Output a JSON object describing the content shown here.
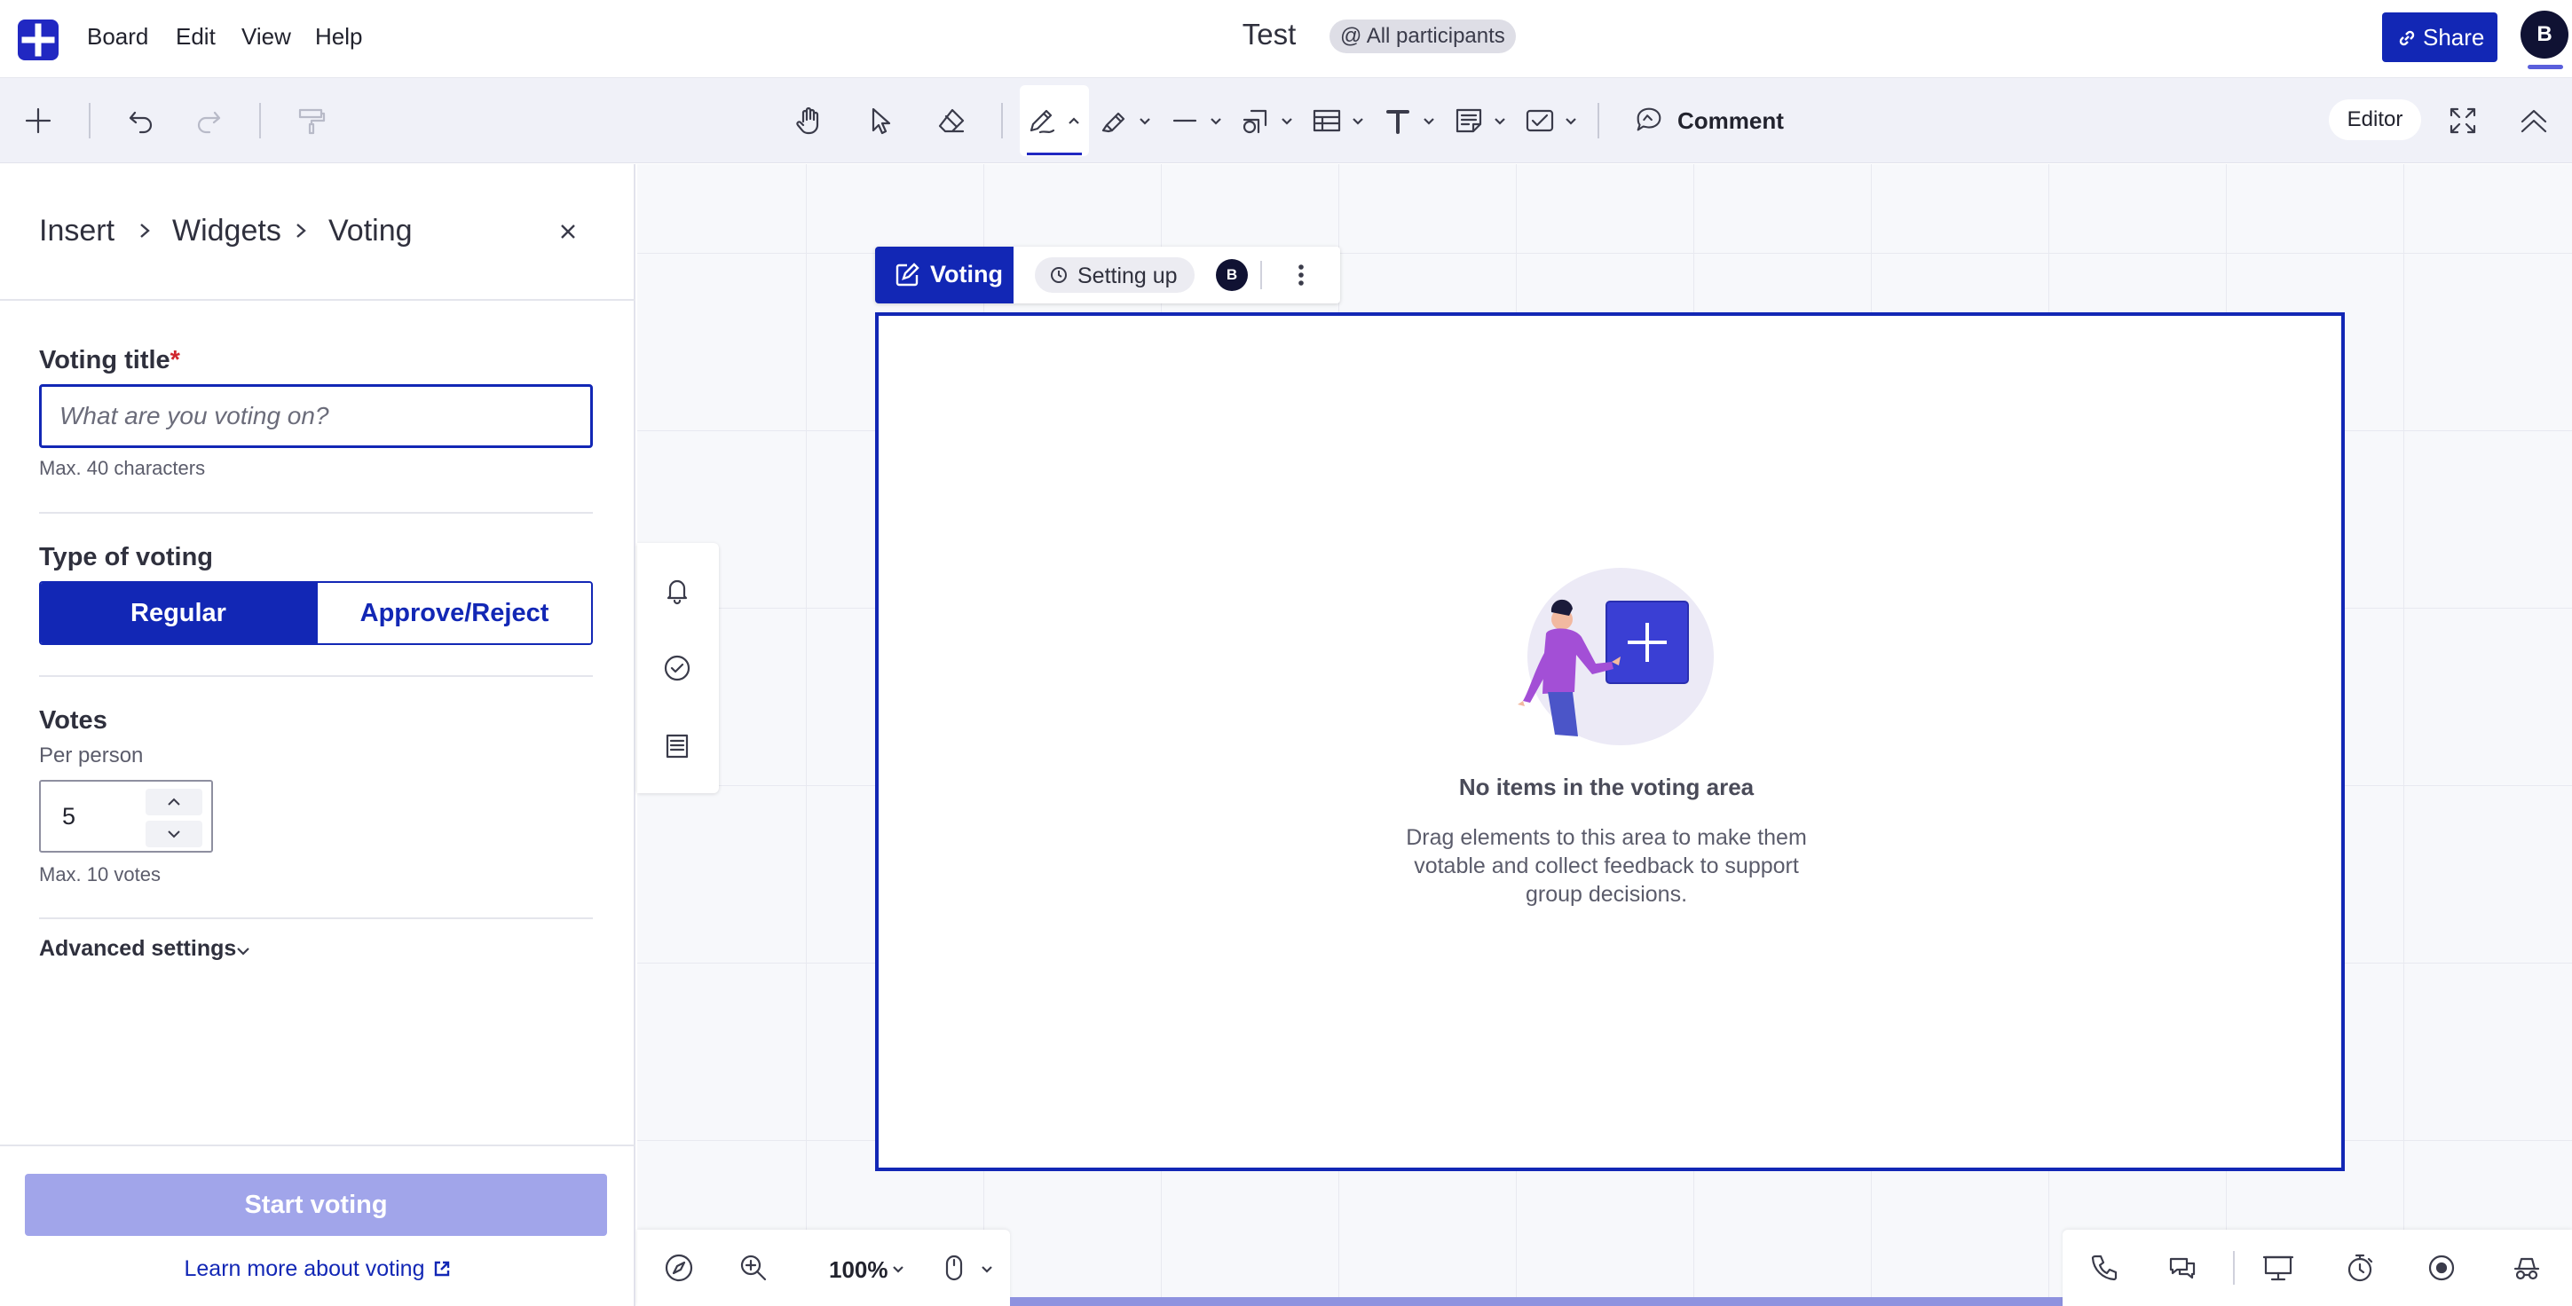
{
  "topbar": {
    "menu": [
      "Board",
      "Edit",
      "View",
      "Help"
    ],
    "board_title": "Test",
    "participants_label": "@ All participants",
    "share_label": "Share",
    "user_initial": "B"
  },
  "toolbar": {
    "tools": [
      "add-icon",
      "undo-icon",
      "redo-icon",
      "format-painter-icon",
      "hand-icon",
      "select-icon",
      "eraser-icon",
      "pen-icon",
      "highlighter-icon",
      "line-icon",
      "shapes-icon",
      "table-icon",
      "text-icon",
      "sticky-note-icon",
      "widget-icon"
    ],
    "comment_label": "Comment",
    "editor_label": "Editor"
  },
  "panel": {
    "breadcrumb": [
      "Insert",
      "Widgets",
      "Voting"
    ],
    "title_label": "Voting title",
    "title_required": "*",
    "title_value": "",
    "title_placeholder": "What are you voting on?",
    "title_hint": "Max. 40 characters",
    "type_label": "Type of voting",
    "type_options": [
      "Regular",
      "Approve/Reject"
    ],
    "type_selected": "Regular",
    "votes_label": "Votes",
    "votes_sublabel": "Per person",
    "votes_value": "5",
    "votes_hint": "Max. 10 votes",
    "advanced_label": "Advanced settings",
    "start_label": "Start voting",
    "learn_label": "Learn more about voting"
  },
  "widget": {
    "tag_label": "Voting",
    "status_label": "Setting up",
    "owner_initial": "B",
    "empty_title": "No items in the voting area",
    "empty_desc": "Drag elements to this area to make them votable and collect feedback to support group decisions."
  },
  "zoom": {
    "level": "100%"
  },
  "colors": {
    "accent": "#1227b5",
    "accent_disabled": "#a1a5ea",
    "avatar": "#101233",
    "required": "#d0262d"
  }
}
